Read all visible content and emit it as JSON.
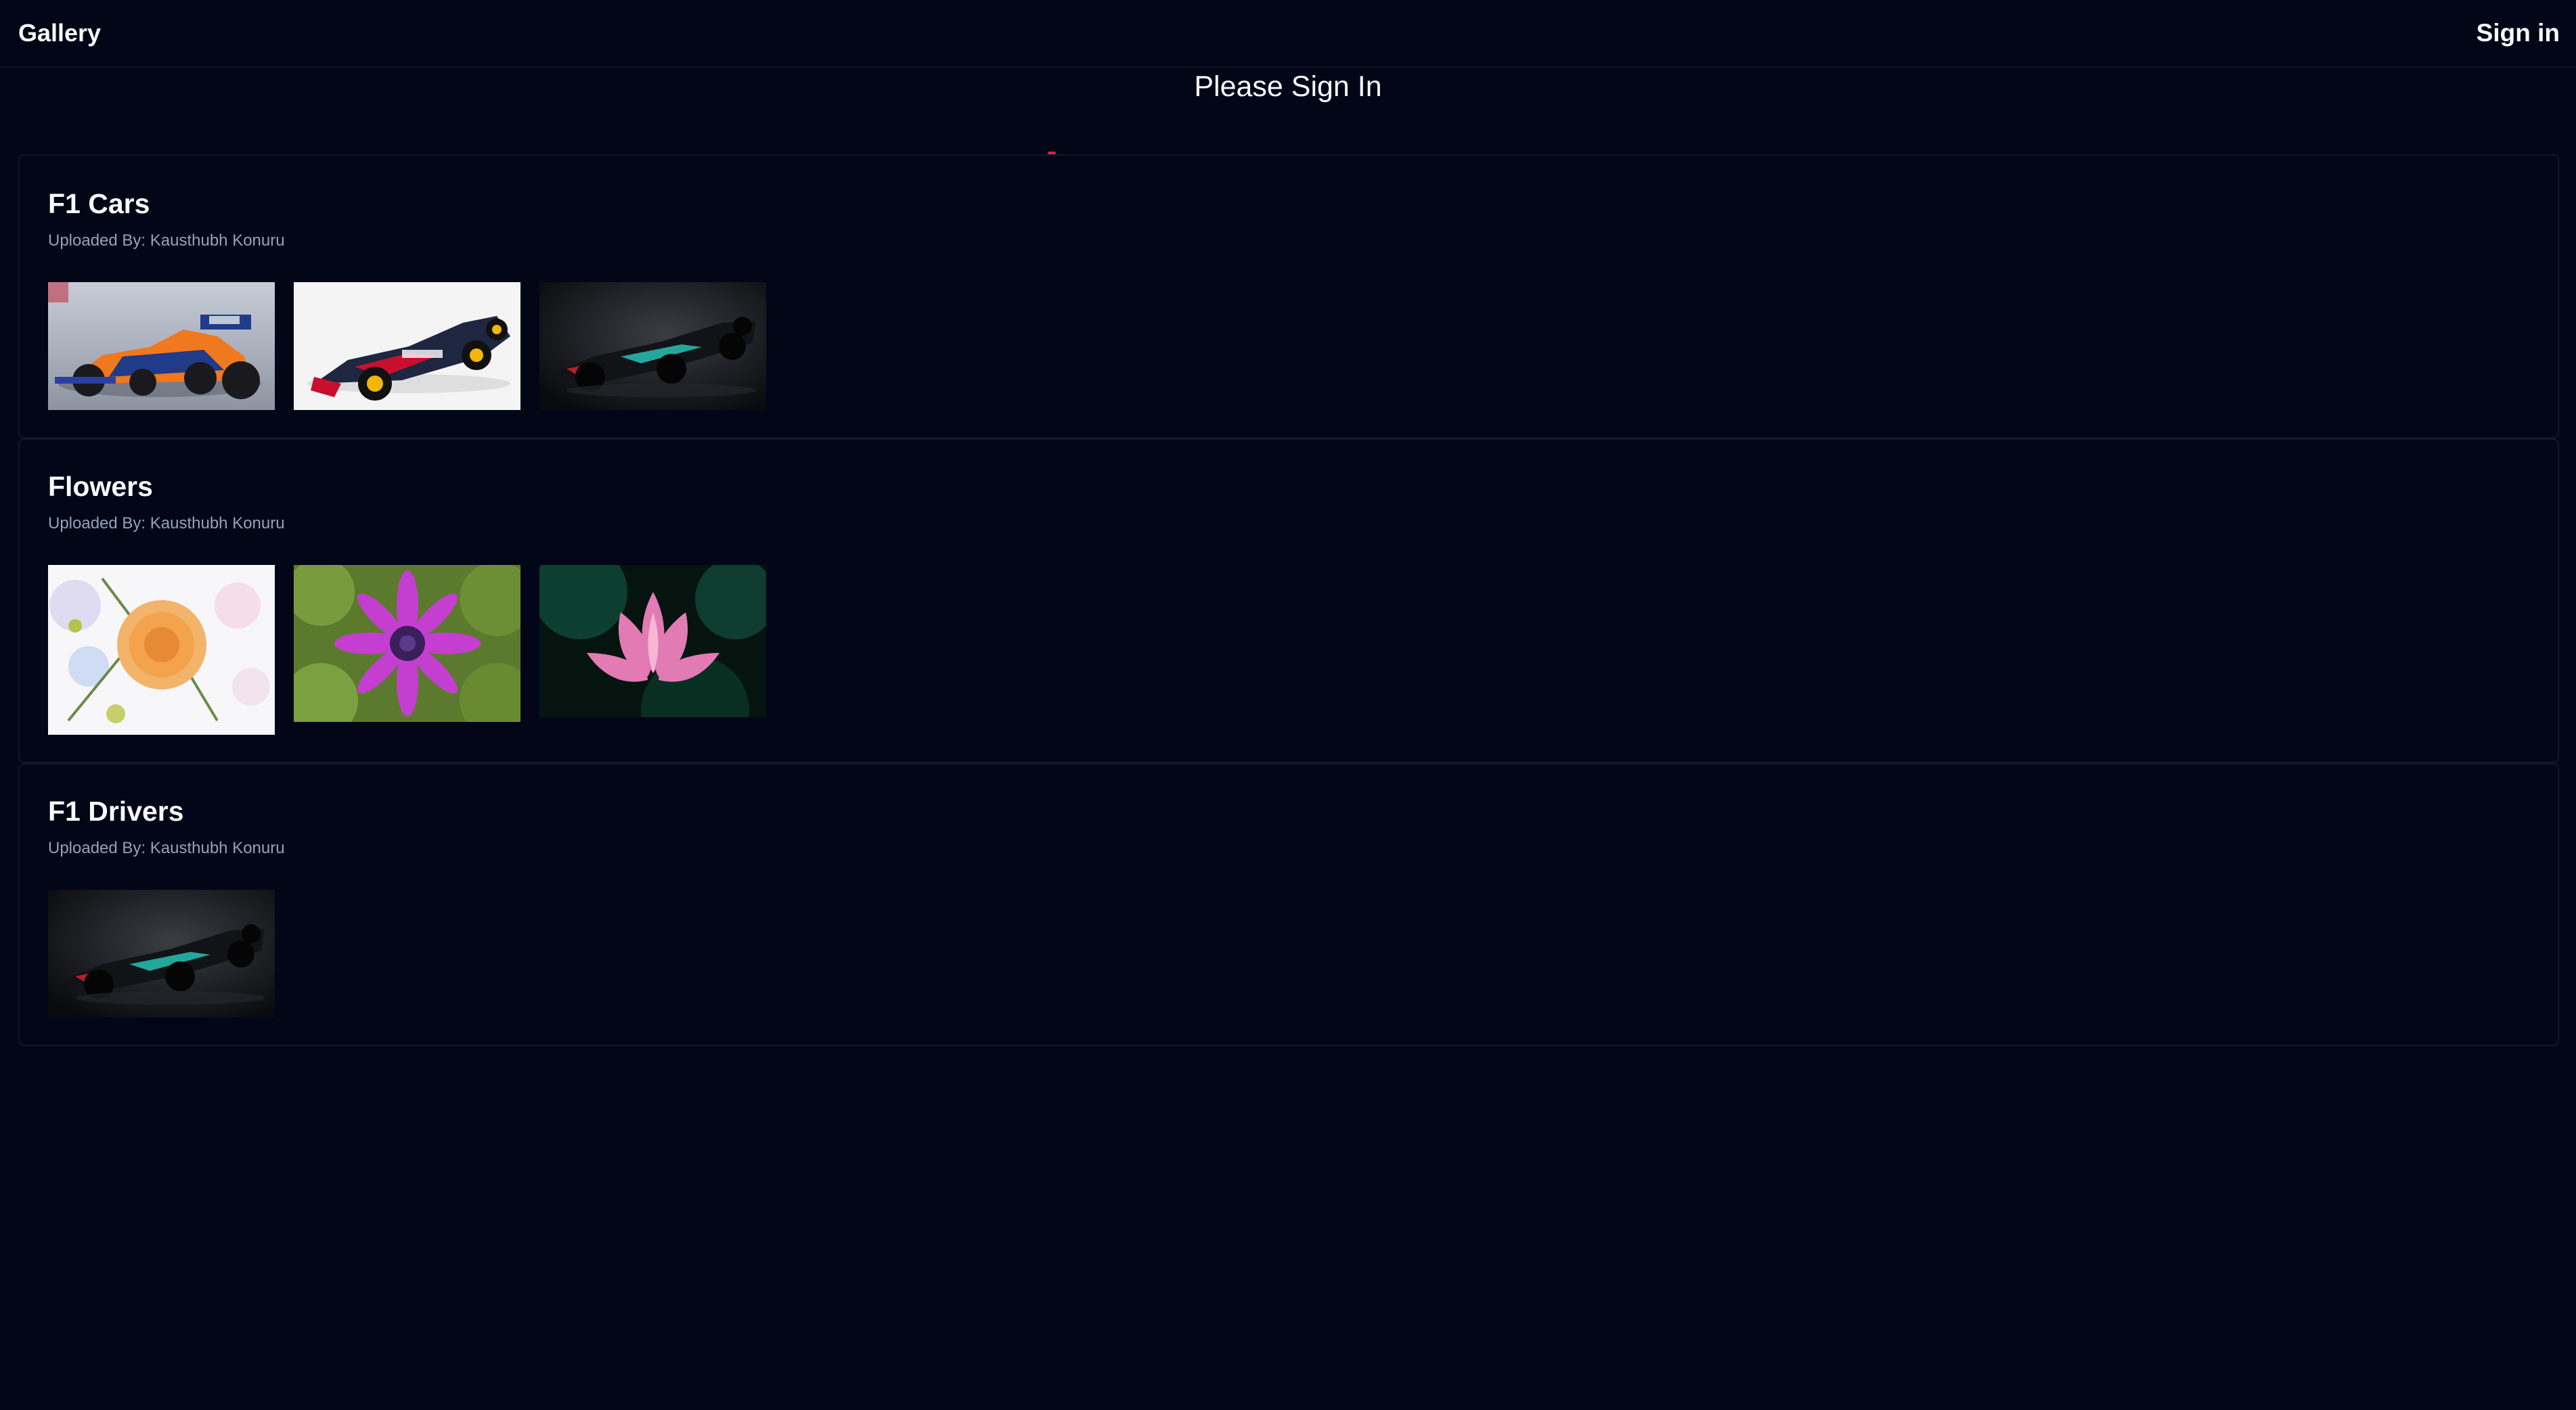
{
  "navbar": {
    "brand": "Gallery",
    "sign_in": "Sign in"
  },
  "heading": "Please Sign In",
  "albums": [
    {
      "title": "F1 Cars",
      "uploader": "Uploaded By: Kausthubh Konuru",
      "images": [
        {
          "subject": "orange-f1-car-on-track"
        },
        {
          "subject": "dark-blue-f1-car-white-background"
        },
        {
          "subject": "black-f1-car-dark-background"
        }
      ]
    },
    {
      "title": "Flowers",
      "uploader": "Uploaded By: Kausthubh Konuru",
      "images": [
        {
          "subject": "peach-rose-bouquet"
        },
        {
          "subject": "purple-daisy"
        },
        {
          "subject": "pink-lotus"
        }
      ]
    },
    {
      "title": "F1 Drivers",
      "uploader": "Uploaded By: Kausthubh Konuru",
      "images": [
        {
          "subject": "black-f1-car-dark-background"
        }
      ]
    }
  ],
  "colors": {
    "background": "#020617",
    "border": "#111827",
    "muted_text": "#94a3b8",
    "text": "#f8fafc",
    "accent_dot": "#e11d48"
  }
}
